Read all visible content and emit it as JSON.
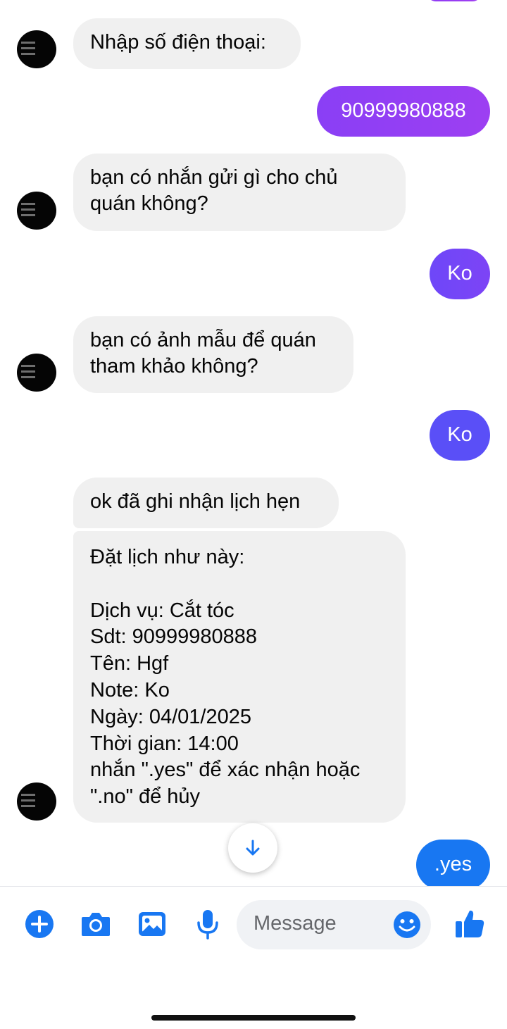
{
  "colors": {
    "incoming_bubble": "#f0f0f0",
    "outgoing_purple": "#9d3ff2",
    "outgoing_violet": "#6e47f8",
    "outgoing_indigo": "#5a4ff7",
    "outgoing_blue": "#1877f2",
    "accent": "#1877f2"
  },
  "messages": [
    {
      "side": "in",
      "text": "Nhập số điện thoại:"
    },
    {
      "side": "out",
      "text": "90999980888"
    },
    {
      "side": "in",
      "text": "bạn có nhắn gửi gì cho chủ\nquán không?"
    },
    {
      "side": "out",
      "text": "Ko"
    },
    {
      "side": "in",
      "text": "bạn có ảnh mẫu để quán\ntham khảo không?"
    },
    {
      "side": "out",
      "text": "Ko"
    },
    {
      "side": "in",
      "text": "ok đã ghi nhận lịch hẹn"
    },
    {
      "side": "in",
      "text": "Đặt lịch như này:\n\nDịch vụ: Cắt tóc\nSdt: 90999980888\nTên: Hgf\nNote: Ko\nNgày: 04/01/2025\nThời gian: 14:00\nnhắn \".yes\" để xác nhận hoặc\n\".no\" để hủy"
    },
    {
      "side": "out",
      "text": ".yes"
    }
  ],
  "composer": {
    "placeholder": "Message",
    "icons": [
      "plus-circle-icon",
      "camera-icon",
      "image-icon",
      "microphone-icon",
      "emoji-icon",
      "thumbs-up-icon"
    ]
  },
  "scroll_button": {
    "icon": "arrow-down-icon"
  }
}
